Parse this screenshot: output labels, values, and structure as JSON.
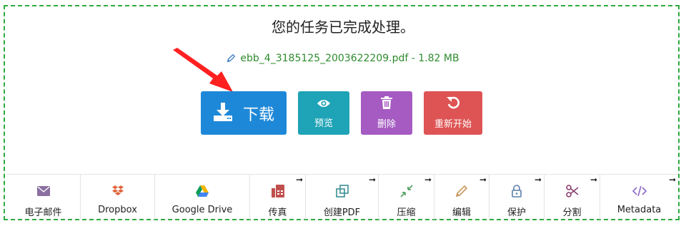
{
  "status": {
    "title": "您的任务已完成处理。",
    "file_name": "ebb_4_3185125_2003622209.pdf",
    "separator": " - ",
    "file_size": "1.82 MB"
  },
  "actions": {
    "download_label": "下载",
    "preview_label": "预览",
    "delete_label": "删除",
    "restart_label": "重新开始"
  },
  "tools": [
    {
      "label": "电子邮件",
      "icon": "envelope-icon",
      "has_arrow": false
    },
    {
      "label": "Dropbox",
      "icon": "dropbox-icon",
      "has_arrow": false
    },
    {
      "label": "Google Drive",
      "icon": "google-drive-icon",
      "has_arrow": false
    },
    {
      "label": "传真",
      "icon": "fax-icon",
      "has_arrow": true
    },
    {
      "label": "创建PDF",
      "icon": "create-pdf-icon",
      "has_arrow": true
    },
    {
      "label": "压缩",
      "icon": "compress-icon",
      "has_arrow": true
    },
    {
      "label": "编辑",
      "icon": "pencil-icon",
      "has_arrow": true
    },
    {
      "label": "保护",
      "icon": "lock-icon",
      "has_arrow": true
    },
    {
      "label": "分割",
      "icon": "scissors-icon",
      "has_arrow": true
    },
    {
      "label": "Metadata",
      "icon": "code-icon",
      "has_arrow": true
    }
  ],
  "corner_arrow": "➞",
  "colors": {
    "frame": "#2eaa3f",
    "file_text": "#2e8b2e",
    "download": "#1e88d8",
    "preview": "#1fa3b6",
    "delete": "#a55bc2",
    "restart": "#de5454",
    "pointer_arrow": "#ff2020"
  }
}
